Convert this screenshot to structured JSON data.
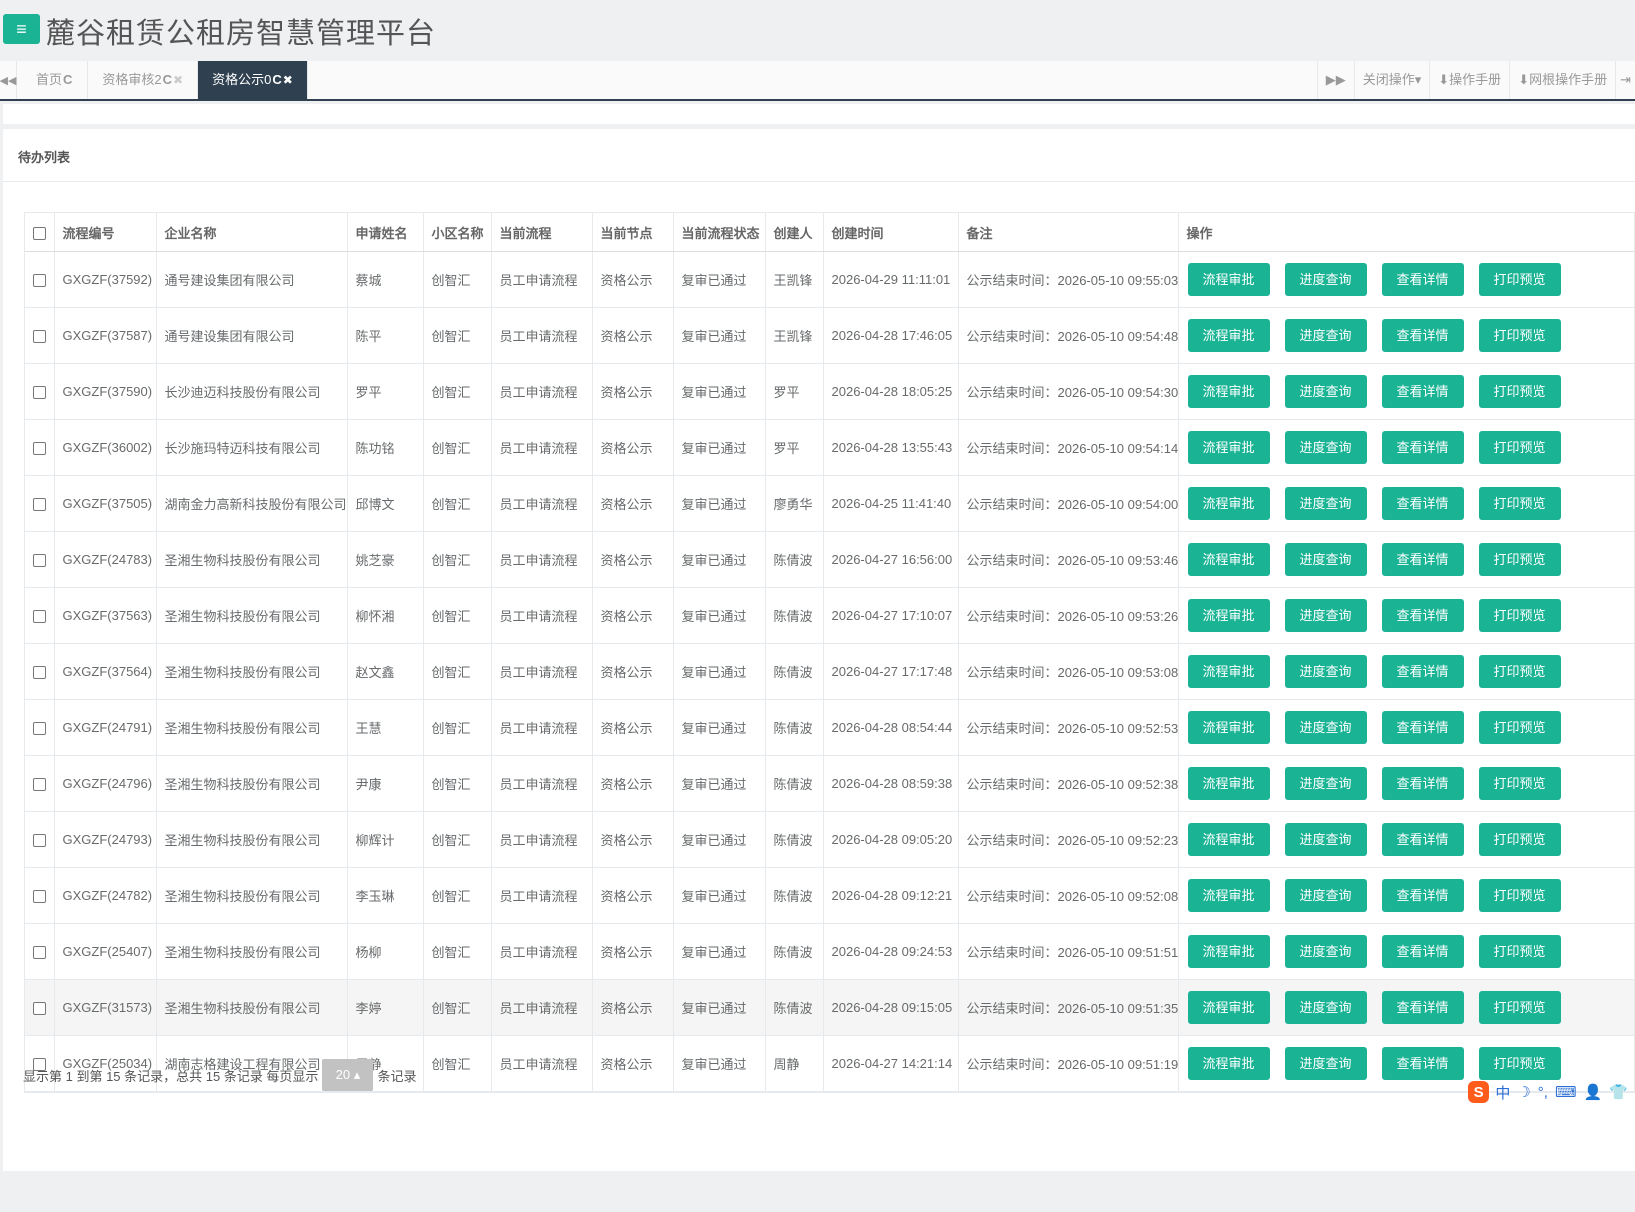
{
  "header": {
    "menu_icon": "hamburger-icon",
    "title": "麓谷租赁公租房智慧管理平台"
  },
  "tabs": [
    {
      "label": "首页",
      "refresh": "C",
      "close": ""
    },
    {
      "label": "资格审核2",
      "refresh": "C",
      "close": "✖"
    },
    {
      "label": "资格公示0",
      "refresh": "C",
      "close": "✖"
    }
  ],
  "toolbar": {
    "close_ops": "关闭操作▾",
    "manual": "⬇操作手册",
    "grid_manual": "⬇网根操作手册"
  },
  "panel": {
    "title": "待办列表"
  },
  "table": {
    "headers": [
      "流程编号",
      "企业名称",
      "申请姓名",
      "小区名称",
      "当前流程",
      "当前节点",
      "当前流程状态",
      "创建人",
      "创建时间",
      "备注",
      "操作"
    ],
    "actions": [
      "流程审批",
      "进度查询",
      "查看详情",
      "打印预览"
    ],
    "rows": [
      [
        "GXGZF(37592)",
        "通号建设集团有限公司",
        "蔡城",
        "创智汇",
        "员工申请流程",
        "资格公示",
        "复审已通过",
        "王凯锋",
        "2026-04-29 11:11:01",
        "公示结束时间：2026-05-10 09:55:03"
      ],
      [
        "GXGZF(37587)",
        "通号建设集团有限公司",
        "陈平",
        "创智汇",
        "员工申请流程",
        "资格公示",
        "复审已通过",
        "王凯锋",
        "2026-04-28 17:46:05",
        "公示结束时间：2026-05-10 09:54:48"
      ],
      [
        "GXGZF(37590)",
        "长沙迪迈科技股份有限公司",
        "罗平",
        "创智汇",
        "员工申请流程",
        "资格公示",
        "复审已通过",
        "罗平",
        "2026-04-28 18:05:25",
        "公示结束时间：2026-05-10 09:54:30"
      ],
      [
        "GXGZF(36002)",
        "长沙施玛特迈科技有限公司",
        "陈功铭",
        "创智汇",
        "员工申请流程",
        "资格公示",
        "复审已通过",
        "罗平",
        "2026-04-28 13:55:43",
        "公示结束时间：2026-05-10 09:54:14"
      ],
      [
        "GXGZF(37505)",
        "湖南金力高新科技股份有限公司",
        "邱博文",
        "创智汇",
        "员工申请流程",
        "资格公示",
        "复审已通过",
        "廖勇华",
        "2026-04-25 11:41:40",
        "公示结束时间：2026-05-10 09:54:00"
      ],
      [
        "GXGZF(24783)",
        "圣湘生物科技股份有限公司",
        "姚芝豪",
        "创智汇",
        "员工申请流程",
        "资格公示",
        "复审已通过",
        "陈倩波",
        "2026-04-27 16:56:00",
        "公示结束时间：2026-05-10 09:53:46"
      ],
      [
        "GXGZF(37563)",
        "圣湘生物科技股份有限公司",
        "柳怀湘",
        "创智汇",
        "员工申请流程",
        "资格公示",
        "复审已通过",
        "陈倩波",
        "2026-04-27 17:10:07",
        "公示结束时间：2026-05-10 09:53:26"
      ],
      [
        "GXGZF(37564)",
        "圣湘生物科技股份有限公司",
        "赵文鑫",
        "创智汇",
        "员工申请流程",
        "资格公示",
        "复审已通过",
        "陈倩波",
        "2026-04-27 17:17:48",
        "公示结束时间：2026-05-10 09:53:08"
      ],
      [
        "GXGZF(24791)",
        "圣湘生物科技股份有限公司",
        "王慧",
        "创智汇",
        "员工申请流程",
        "资格公示",
        "复审已通过",
        "陈倩波",
        "2026-04-28 08:54:44",
        "公示结束时间：2026-05-10 09:52:53"
      ],
      [
        "GXGZF(24796)",
        "圣湘生物科技股份有限公司",
        "尹康",
        "创智汇",
        "员工申请流程",
        "资格公示",
        "复审已通过",
        "陈倩波",
        "2026-04-28 08:59:38",
        "公示结束时间：2026-05-10 09:52:38"
      ],
      [
        "GXGZF(24793)",
        "圣湘生物科技股份有限公司",
        "柳辉计",
        "创智汇",
        "员工申请流程",
        "资格公示",
        "复审已通过",
        "陈倩波",
        "2026-04-28 09:05:20",
        "公示结束时间：2026-05-10 09:52:23"
      ],
      [
        "GXGZF(24782)",
        "圣湘生物科技股份有限公司",
        "李玉琳",
        "创智汇",
        "员工申请流程",
        "资格公示",
        "复审已通过",
        "陈倩波",
        "2026-04-28 09:12:21",
        "公示结束时间：2026-05-10 09:52:08"
      ],
      [
        "GXGZF(25407)",
        "圣湘生物科技股份有限公司",
        "杨柳",
        "创智汇",
        "员工申请流程",
        "资格公示",
        "复审已通过",
        "陈倩波",
        "2026-04-28 09:24:53",
        "公示结束时间：2026-05-10 09:51:51"
      ],
      [
        "GXGZF(31573)",
        "圣湘生物科技股份有限公司",
        "李婷",
        "创智汇",
        "员工申请流程",
        "资格公示",
        "复审已通过",
        "陈倩波",
        "2026-04-28 09:15:05",
        "公示结束时间：2026-05-10 09:51:35"
      ],
      [
        "GXGZF(25034)",
        "湖南志格建设工程有限公司",
        "周静",
        "创智汇",
        "员工申请流程",
        "资格公示",
        "复审已通过",
        "周静",
        "2026-04-27 14:21:14",
        "公示结束时间：2026-05-10 09:51:19"
      ]
    ]
  },
  "pager": {
    "summary": "显示第 1 到第 15 条记录，总共 15 条记录 每页显示",
    "page_size": "20 ▴",
    "suffix": "条记录"
  },
  "ime": {
    "logo": "S",
    "mode": "中",
    "items": [
      "☽",
      "°,",
      "⌨",
      "👤",
      "👕"
    ]
  },
  "colors": {
    "accent": "#1ab394",
    "nav_dark": "#2f4050",
    "page_bg": "#eff0f2"
  }
}
